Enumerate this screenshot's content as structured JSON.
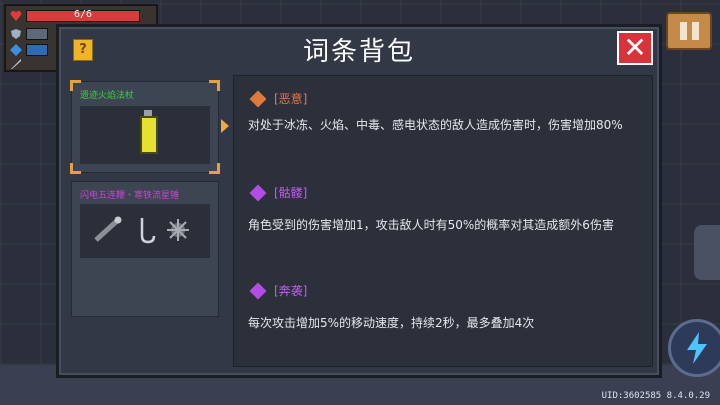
{
  "hud": {
    "hp_text": "6/6",
    "hp_fraction": 1.0,
    "colors": {
      "hp": "#d63c3c",
      "armor": "#8fa3bd",
      "energy": "#3d8ee0"
    }
  },
  "modal": {
    "title": "词条背包",
    "help_label": "?",
    "close_label": "✕"
  },
  "items": [
    {
      "name": "遗迹火焰法杖",
      "name_color": "#39d13c",
      "selected": true,
      "icon": "lighter-icon"
    },
    {
      "name": "闪电五连鞭・寒铁流星锤",
      "name_color": "#c844d6",
      "selected": false,
      "icons": [
        "bone-club-icon",
        "hook-icon",
        "spiked-mace-icon"
      ]
    }
  ],
  "affixes": [
    {
      "tag": "[恶意]",
      "tag_color": "#e8744a",
      "gem_color": "#e07a3a",
      "desc": "对处于冰冻、火焰、中毒、感电状态的敌人造成伤害时，伤害增加80%"
    },
    {
      "tag": "[骷髅]",
      "tag_color": "#c35cf0",
      "gem_color": "#b24ee6",
      "desc": "角色受到的伤害增加1，攻击敌人时有50%的概率对其造成额外6伤害"
    },
    {
      "tag": "[奔袭]",
      "tag_color": "#c35cf0",
      "gem_color": "#b24ee6",
      "desc": "每次攻击增加5%的移动速度，持续2秒，最多叠加4次"
    }
  ],
  "version_text": "UID:3602585 8.4.0.29"
}
